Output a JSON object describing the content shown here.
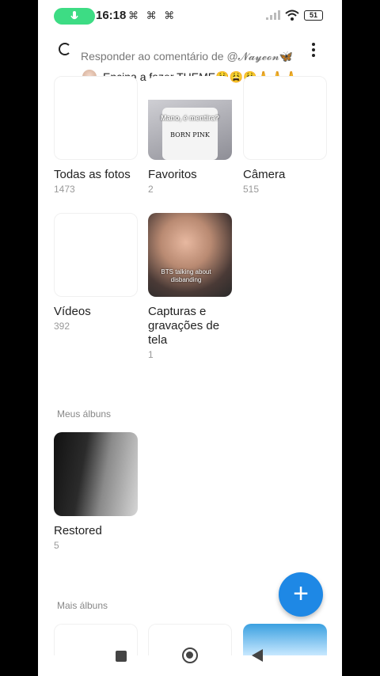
{
  "status": {
    "time": "16:18",
    "left_icons": "₂₂₂",
    "battery": "51"
  },
  "header": {
    "reply_text": "Responder ao comentário de @𝓝𝓪𝔂𝓮𝓸𝓷🦋"
  },
  "comment": {
    "text": "Encina a fazer THEME😩😩😩🙏🙏🙏"
  },
  "albums": [
    {
      "label": "Todas as fotos",
      "count": "1473"
    },
    {
      "label": "Favoritos",
      "count": "2",
      "overlay_top": "Mano, é mentira?",
      "overlay_mid": "BORN PINK"
    },
    {
      "label": "Câmera",
      "count": "515"
    },
    {
      "label": "Vídeos",
      "count": "392"
    },
    {
      "label": "Capturas e gravações de tela",
      "count": "1",
      "overlay": "BTS talking about disbanding"
    }
  ],
  "my_albums": {
    "heading": "Meus álbuns",
    "items": [
      {
        "label": "Restored",
        "count": "5"
      }
    ]
  },
  "more_albums": {
    "heading": "Mais álbuns"
  },
  "fab": {
    "icon": "plus-icon",
    "symbol": "+"
  },
  "colors": {
    "accent": "#1e88e5",
    "mic": "#3ddc84"
  }
}
